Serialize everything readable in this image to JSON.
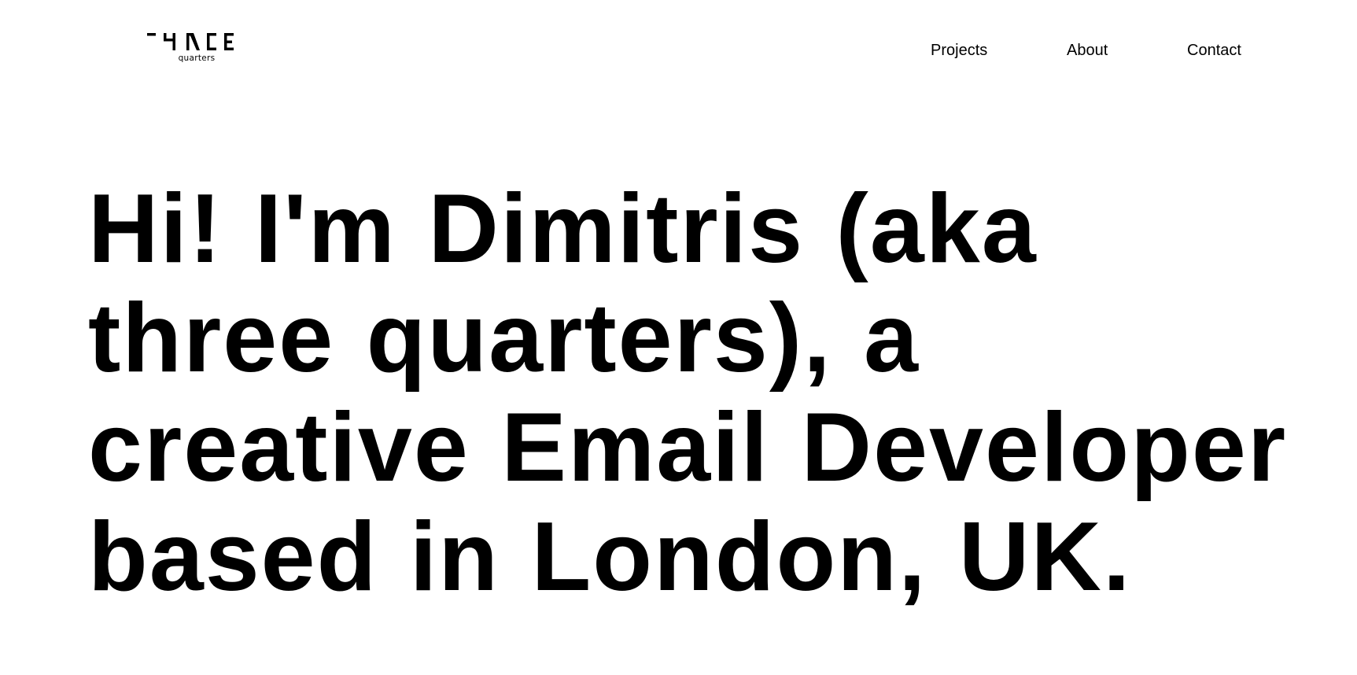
{
  "header": {
    "logo": {
      "mark_text": "THREE",
      "sub_text": "quarters"
    },
    "nav": {
      "projects": "Projects",
      "about": "About",
      "contact": "Contact"
    }
  },
  "hero": {
    "headline": "Hi! I'm Dimitris (aka three quarters), a creative Email Developer based in London, UK."
  },
  "colors": {
    "background": "#ffffff",
    "text": "#000000"
  }
}
